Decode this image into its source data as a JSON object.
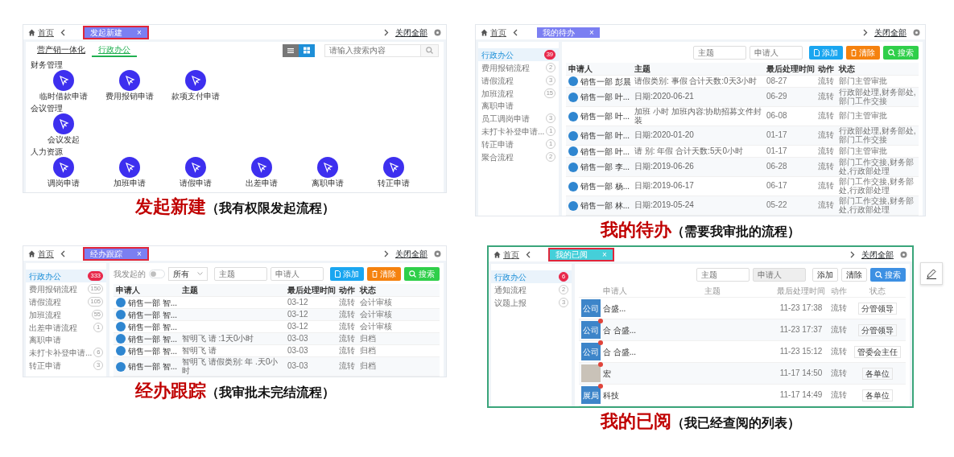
{
  "panels": [
    {
      "kind": "launcher",
      "framed": false,
      "tabbar": {
        "home": "首页",
        "tab": {
          "label": "发起新建",
          "close": "×",
          "color": "#7b7ff2",
          "highlighted": true
        },
        "close_all": "关闭全部"
      },
      "categories": [
        {
          "label": "营产销一体化",
          "selected": false
        },
        {
          "label": "行政办公",
          "selected": true
        }
      ],
      "view_modes": [
        {
          "kind": "list",
          "selected": false
        },
        {
          "kind": "grid",
          "selected": true
        }
      ],
      "search": {
        "placeholder": "请输入搜索内容"
      },
      "groups": [
        {
          "title": "财务管理",
          "items": [
            "临时借款申请",
            "费用报销申请",
            "款项支付申请"
          ]
        },
        {
          "title": "会议管理",
          "items": [
            "会议发起"
          ]
        },
        {
          "title": "人力资源",
          "items": [
            "调岗申请",
            "加班申请",
            "请假申请",
            "出差申请",
            "离职申请",
            "转正申请"
          ]
        }
      ],
      "caption": {
        "title": "发起新建",
        "note": "（我有权限发起流程）"
      }
    },
    {
      "kind": "table",
      "framed": false,
      "tabbar": {
        "home": "首页",
        "tab": {
          "label": "我的待办",
          "close": "×",
          "color": "#7b7ff2",
          "highlighted": false
        },
        "close_all": "关闭全部"
      },
      "sidebar": [
        {
          "label": "行政办公",
          "count": "39",
          "selected": true
        },
        {
          "label": "费用报销流程",
          "count": "2",
          "selected": false
        },
        {
          "label": "请假流程",
          "count": "3",
          "selected": false
        },
        {
          "label": "加班流程",
          "count": "15",
          "selected": false
        },
        {
          "label": "离职申请",
          "selected": false
        },
        {
          "label": "员工调岗申请",
          "count": "3",
          "selected": false
        },
        {
          "label": "未打卡补登申请...",
          "count": "1",
          "selected": false
        },
        {
          "label": "转正申请",
          "count": "1",
          "selected": false
        },
        {
          "label": "聚合流程",
          "count": "2",
          "selected": false
        }
      ],
      "filters": [
        {
          "placeholder": "主题",
          "disabled": false
        },
        {
          "placeholder": "申请人",
          "disabled": false
        }
      ],
      "buttons": [
        {
          "kind": "add",
          "label": "添加",
          "color": "#1aa6f0"
        },
        {
          "kind": "clear",
          "label": "清除",
          "color": "#f5820f"
        },
        {
          "kind": "search",
          "label": "搜索",
          "color": "#2fcf4a"
        }
      ],
      "columns": [
        "申请人",
        "主题",
        "最后处理时间",
        "动作",
        "状态"
      ],
      "rows": [
        {
          "avatar": {
            "kind": "circle"
          },
          "applicant": "销售一部 彭晨",
          "subject": "请假类别: 事假 合计天数:0天3小时",
          "time": "08-27",
          "action": "流转",
          "status": "部门主管审批"
        },
        {
          "avatar": {
            "kind": "circle"
          },
          "applicant": "销售一部 叶...",
          "subject": "日期:2020-06-21",
          "time": "06-29",
          "action": "流转",
          "status": "行政部处理,财务部处,部门工作交接"
        },
        {
          "avatar": {
            "kind": "circle"
          },
          "applicant": "销售一部 叶...",
          "subject": "加班 小时 加班内容:协助招募文件封装",
          "time": "06-08",
          "action": "流转",
          "status": "部门主管审批"
        },
        {
          "avatar": {
            "kind": "circle"
          },
          "applicant": "销售一部 叶...",
          "subject": "日期:2020-01-20",
          "time": "01-17",
          "action": "流转",
          "status": "行政部处理,财务部处,部门工作交接"
        },
        {
          "avatar": {
            "kind": "circle"
          },
          "applicant": "销售一部 叶...",
          "subject": "请 别: 年假 合计天数:5天0小时",
          "time": "01-17",
          "action": "流转",
          "status": "部门主管审批"
        },
        {
          "avatar": {
            "kind": "circle"
          },
          "applicant": "销售一部 李...",
          "subject": "日期:2019-06-26",
          "time": "06-28",
          "action": "流转",
          "status": "部门工作交接,财务部处,行政部处理"
        },
        {
          "avatar": {
            "kind": "circle"
          },
          "applicant": "销售一部 杨...",
          "subject": "日期:2019-06-17",
          "time": "06-17",
          "action": "流转",
          "status": "部门工作交接,财务部处,行政部处理"
        },
        {
          "avatar": {
            "kind": "circle"
          },
          "applicant": "销售一部 林...",
          "subject": "日期:2019-05-24",
          "time": "05-22",
          "action": "流转",
          "status": "部门工作交接,财务部处,行政部处理"
        }
      ],
      "caption": {
        "title": "我的待办",
        "note": "（需要我审批的流程）"
      }
    },
    {
      "kind": "table",
      "framed": false,
      "tabbar": {
        "home": "首页",
        "tab": {
          "label": "经办跟踪",
          "close": "×",
          "color": "#7b7ff2",
          "highlighted": true
        },
        "close_all": "关闭全部"
      },
      "sidebar": [
        {
          "label": "行政办公",
          "count": "333",
          "selected": true
        },
        {
          "label": "费用报销流程",
          "count": "150",
          "selected": false
        },
        {
          "label": "请假流程",
          "count": "105",
          "selected": false
        },
        {
          "label": "加班流程",
          "count": "55",
          "selected": false
        },
        {
          "label": "出差申请流程",
          "count": "1",
          "selected": false
        },
        {
          "label": "离职申请",
          "selected": false
        },
        {
          "label": "未打卡补登申请...",
          "count": "6",
          "selected": false
        },
        {
          "label": "转正申请",
          "count": "3",
          "selected": false
        }
      ],
      "toggle": {
        "label": "我发起的",
        "on": false
      },
      "select": {
        "value": "所有"
      },
      "filters": [
        {
          "placeholder": "主题",
          "disabled": false
        },
        {
          "placeholder": "申请人",
          "disabled": false
        }
      ],
      "buttons": [
        {
          "kind": "add",
          "label": "添加",
          "color": "#1aa6f0"
        },
        {
          "kind": "clear",
          "label": "清除",
          "color": "#f5820f"
        },
        {
          "kind": "search",
          "label": "搜索",
          "color": "#2fcf4a"
        }
      ],
      "columns": [
        "申请人",
        "主题",
        "最后处理时间",
        "动作",
        "状态"
      ],
      "rows": [
        {
          "avatar": {
            "kind": "circle"
          },
          "applicant": "销售一部 智...",
          "time": "03-12",
          "action": "流转",
          "status": "会计审核"
        },
        {
          "avatar": {
            "kind": "circle"
          },
          "applicant": "销售一部 智...",
          "time": "03-12",
          "action": "流转",
          "status": "会计审核"
        },
        {
          "avatar": {
            "kind": "circle"
          },
          "applicant": "销售一部 智...",
          "time": "03-12",
          "action": "流转",
          "status": "会计审核"
        },
        {
          "avatar": {
            "kind": "circle"
          },
          "applicant": "销售一部 智...",
          "subject": "智明飞 请 :1天0小时",
          "time": "03-03",
          "action": "流转",
          "status": "归档"
        },
        {
          "avatar": {
            "kind": "circle"
          },
          "applicant": "销售一部 智...",
          "subject": "智明飞 请",
          "time": "03-03",
          "action": "流转",
          "status": "归档"
        },
        {
          "avatar": {
            "kind": "circle"
          },
          "applicant": "销售一部 智...",
          "subject": "智明飞 请假类别: 年 .天0小时",
          "time": "03-03",
          "action": "流转",
          "status": "归档"
        }
      ],
      "caption": {
        "title": "经办跟踪",
        "note": "（我审批未完结流程）"
      }
    },
    {
      "kind": "tag_table",
      "framed": true,
      "tabbar": {
        "home": "首页",
        "tab": {
          "label": "我的已阅",
          "close": "×",
          "color": "#45cfd9",
          "highlighted": true
        },
        "close_all": "关闭全部"
      },
      "sidebar": [
        {
          "label": "行政办公",
          "count": "6",
          "selected": true
        },
        {
          "label": "通知流程",
          "count": "2",
          "selected": false
        },
        {
          "label": "议题上报",
          "count": "3",
          "selected": false
        }
      ],
      "filters": [
        {
          "placeholder": "主题",
          "disabled": false
        },
        {
          "placeholder": "申请人",
          "disabled": true
        }
      ],
      "buttons": [
        {
          "kind": "plain",
          "label": "添加",
          "color": "#ffffff"
        },
        {
          "kind": "plain",
          "label": "清除",
          "color": "#ffffff"
        },
        {
          "kind": "search",
          "label": "搜索",
          "color": "#3d90e3"
        }
      ],
      "columns": [
        "申请人",
        "主题",
        "最后处理时间",
        "动作",
        "状态"
      ],
      "rows": [
        {
          "avatar": {
            "kind": "text",
            "label": "公司"
          },
          "unread": false,
          "applicant": "合盛...",
          "time": "11-23 17:38",
          "action": "流转",
          "status": "分管领导"
        },
        {
          "avatar": {
            "kind": "text",
            "label": "公司"
          },
          "unread": true,
          "applicant": "合 合盛...",
          "time": "11-23 17:37",
          "action": "流转",
          "status": "分管领导"
        },
        {
          "avatar": {
            "kind": "text",
            "label": "公司"
          },
          "unread": true,
          "applicant": "合 合盛...",
          "time": "11-23 15:12",
          "action": "流转",
          "status": "管委会主任"
        },
        {
          "avatar": {
            "kind": "photo"
          },
          "unread": true,
          "applicant": "宏",
          "time": "11-17 14:50",
          "action": "流转",
          "status": "各单位"
        },
        {
          "avatar": {
            "kind": "text",
            "label": "展局"
          },
          "unread": true,
          "applicant": "科技",
          "time": "11-17 14:49",
          "action": "流转",
          "status": "各单位"
        }
      ],
      "caption": {
        "title": "我的已阅",
        "note": "（我已经查阅的列表）"
      }
    }
  ]
}
